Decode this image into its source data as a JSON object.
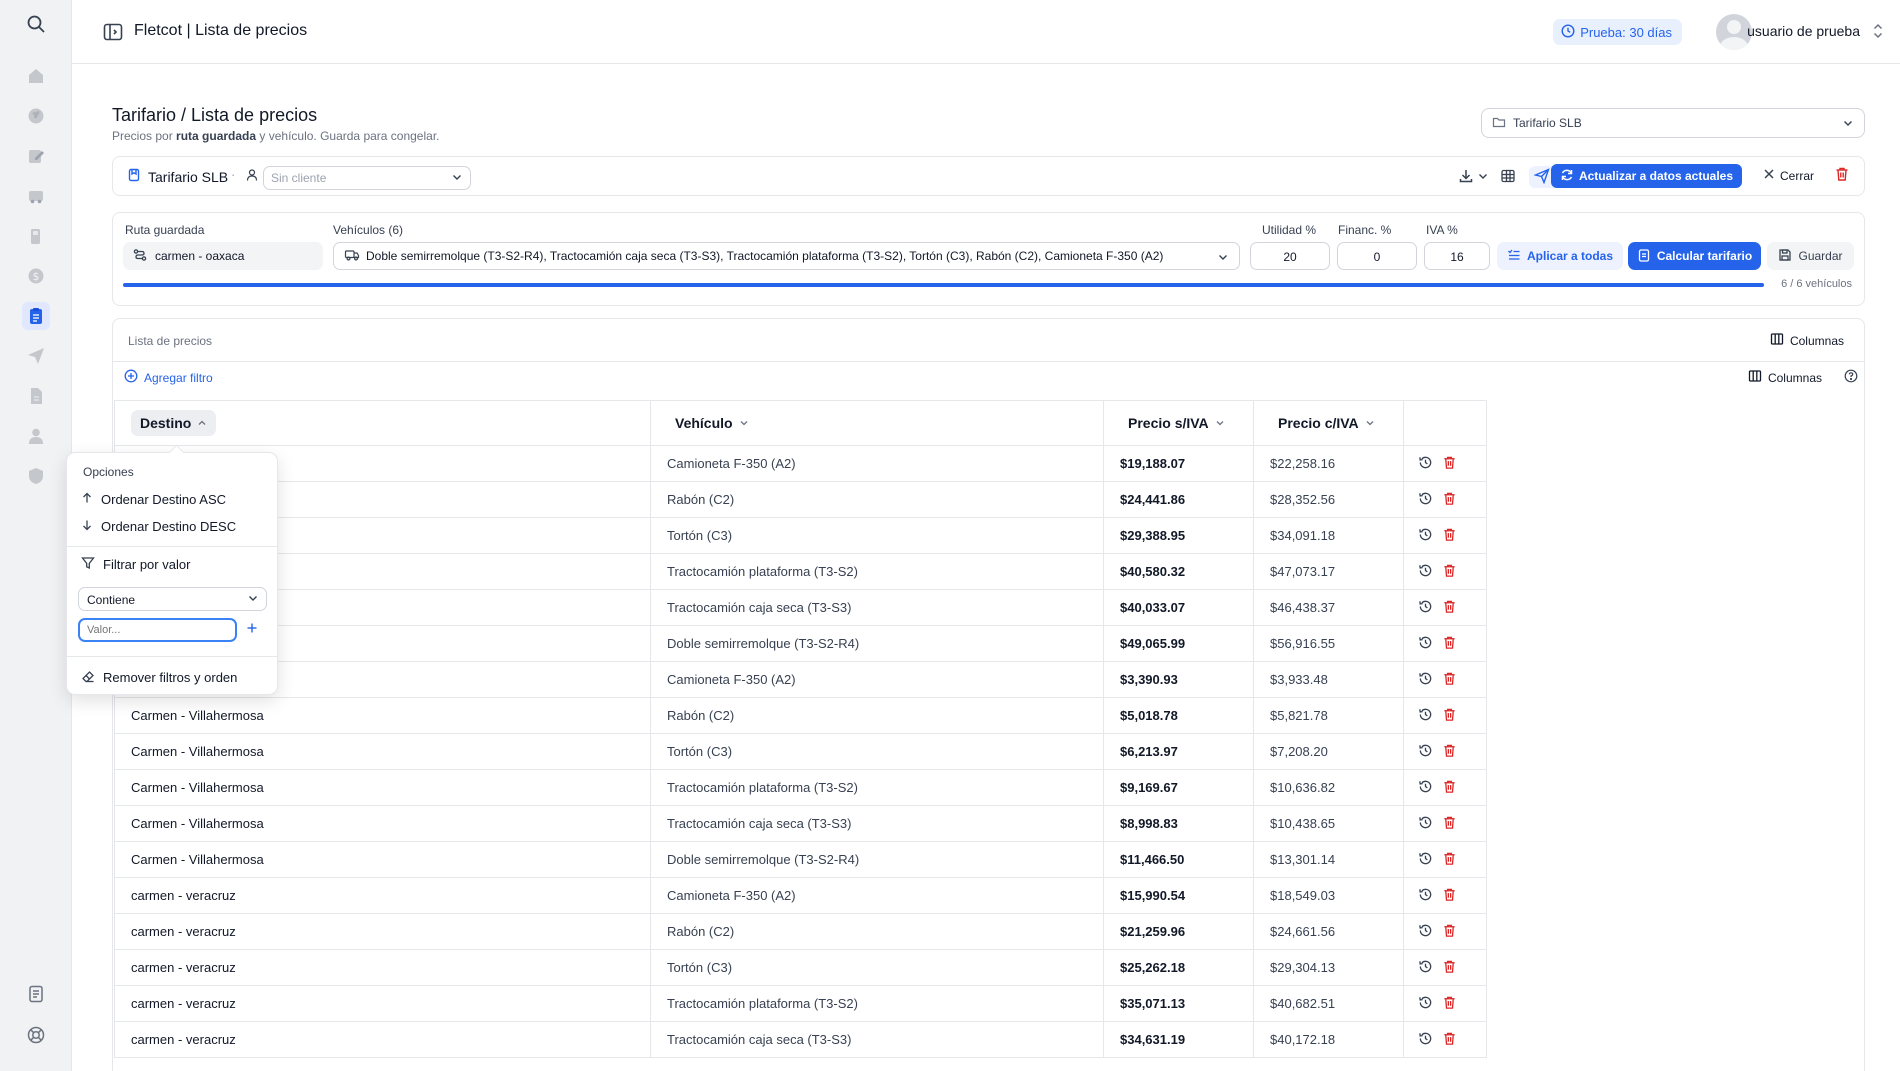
{
  "topbar": {
    "title": "Fletcot | Lista de precios",
    "trial_badge": "Prueba: 30 días",
    "user_name": "usuario de prueba"
  },
  "page": {
    "title": "Tarifario / Lista de precios",
    "subtitle_pre": "Precios por ",
    "subtitle_bold": "ruta guardada",
    "subtitle_post": " y vehículo. Guarda para congelar.",
    "tariff_select": "Tarifario SLB"
  },
  "tariff_bar": {
    "name": "Tarifario SLB",
    "separator": "·",
    "client_placeholder": "Sin cliente",
    "update_button": "Actualizar a datos actuales",
    "close_button": "Cerrar"
  },
  "config": {
    "route_label": "Ruta guardada",
    "route_value": "carmen - oaxaca",
    "vehicles_label": "Vehículos (6)",
    "vehicles_value": "Doble semirremolque (T3-S2-R4), Tractocamión caja seca (T3-S3), Tractocamión plataforma (T3-S2), Tortón (C3), Rabón (C2), Camioneta F-350 (A2)",
    "utilidad_label": "Utilidad %",
    "utilidad_value": "20",
    "financ_label": "Financ. %",
    "financ_value": "0",
    "iva_label": "IVA %",
    "iva_value": "16",
    "apply_button": "Aplicar a todas",
    "calc_button": "Calcular tarifario",
    "save_button": "Guardar",
    "progress_text": "6 / 6 vehículos",
    "progress": 1.0
  },
  "table_panel": {
    "title": "Lista de precios",
    "columns_button": "Columnas",
    "columns_button_2": "Columnas",
    "add_filter": "Agregar filtro",
    "headers": [
      "Destino",
      "Vehículo",
      "Precio s/IVA",
      "Precio c/IVA"
    ],
    "rows": [
      {
        "destino": "",
        "vehiculo": "Camioneta F-350 (A2)",
        "s_iva": "$19,188.07",
        "c_iva": "$22,258.16"
      },
      {
        "destino": "",
        "vehiculo": "Rabón (C2)",
        "s_iva": "$24,441.86",
        "c_iva": "$28,352.56"
      },
      {
        "destino": "",
        "vehiculo": "Tortón (C3)",
        "s_iva": "$29,388.95",
        "c_iva": "$34,091.18"
      },
      {
        "destino": "",
        "vehiculo": "Tractocamión plataforma (T3-S2)",
        "s_iva": "$40,580.32",
        "c_iva": "$47,073.17"
      },
      {
        "destino": "",
        "vehiculo": "Tractocamión caja seca (T3-S3)",
        "s_iva": "$40,033.07",
        "c_iva": "$46,438.37"
      },
      {
        "destino": "",
        "vehiculo": "Doble semirremolque (T3-S2-R4)",
        "s_iva": "$49,065.99",
        "c_iva": "$56,916.55"
      },
      {
        "destino": "",
        "vehiculo": "Camioneta F-350 (A2)",
        "s_iva": "$3,390.93",
        "c_iva": "$3,933.48"
      },
      {
        "destino": "Carmen - Villahermosa",
        "vehiculo": "Rabón (C2)",
        "s_iva": "$5,018.78",
        "c_iva": "$5,821.78"
      },
      {
        "destino": "Carmen - Villahermosa",
        "vehiculo": "Tortón (C3)",
        "s_iva": "$6,213.97",
        "c_iva": "$7,208.20"
      },
      {
        "destino": "Carmen - Villahermosa",
        "vehiculo": "Tractocamión plataforma (T3-S2)",
        "s_iva": "$9,169.67",
        "c_iva": "$10,636.82"
      },
      {
        "destino": "Carmen - Villahermosa",
        "vehiculo": "Tractocamión caja seca (T3-S3)",
        "s_iva": "$8,998.83",
        "c_iva": "$10,438.65"
      },
      {
        "destino": "Carmen - Villahermosa",
        "vehiculo": "Doble semirremolque (T3-S2-R4)",
        "s_iva": "$11,466.50",
        "c_iva": "$13,301.14"
      },
      {
        "destino": "carmen - veracruz",
        "vehiculo": "Camioneta F-350 (A2)",
        "s_iva": "$15,990.54",
        "c_iva": "$18,549.03"
      },
      {
        "destino": "carmen - veracruz",
        "vehiculo": "Rabón (C2)",
        "s_iva": "$21,259.96",
        "c_iva": "$24,661.56"
      },
      {
        "destino": "carmen - veracruz",
        "vehiculo": "Tortón (C3)",
        "s_iva": "$25,262.18",
        "c_iva": "$29,304.13"
      },
      {
        "destino": "carmen - veracruz",
        "vehiculo": "Tractocamión plataforma (T3-S2)",
        "s_iva": "$35,071.13",
        "c_iva": "$40,682.51"
      },
      {
        "destino": "carmen - veracruz",
        "vehiculo": "Tractocamión caja seca (T3-S3)",
        "s_iva": "$34,631.19",
        "c_iva": "$40,172.18"
      }
    ]
  },
  "popup": {
    "header": "Opciones",
    "sort_asc": "Ordenar Destino ASC",
    "sort_desc": "Ordenar Destino DESC",
    "filter_by_value": "Filtrar por valor",
    "operator": "Contiene",
    "value_placeholder": "Valor...",
    "remove_filters": "Remover filtros y orden"
  },
  "colors": {
    "accent": "#2563eb",
    "danger": "#dc2626",
    "sidebar_bg": "#f1f2f4"
  }
}
